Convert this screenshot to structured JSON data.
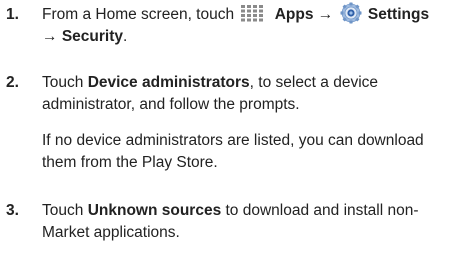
{
  "steps": [
    {
      "number": "1.",
      "line1_prefix": "From a Home screen, touch",
      "apps_label": "Apps",
      "arrow1": "→",
      "settings_label": "Settings",
      "arrow2": "→",
      "security_label": "Security",
      "period": ".",
      "icons": [
        "apps-grid-icon",
        "settings-gear-icon"
      ]
    },
    {
      "number": "2.",
      "prefix": "Touch",
      "bold_term": "Device administrators",
      "suffix": ", to select a device administrator, and follow the prompts.",
      "note": "If no device administrators are listed, you can download them from the Play Store."
    },
    {
      "number": "3.",
      "prefix": "Touch",
      "bold_term": "Unknown sources",
      "suffix": "to download and install non-Market applications."
    }
  ],
  "colors": {
    "text": "#222222",
    "apps_icon": "#8a8a8a",
    "settings_icon_ring": "#7fa7d6",
    "settings_icon_center": "#2f5fa8"
  }
}
